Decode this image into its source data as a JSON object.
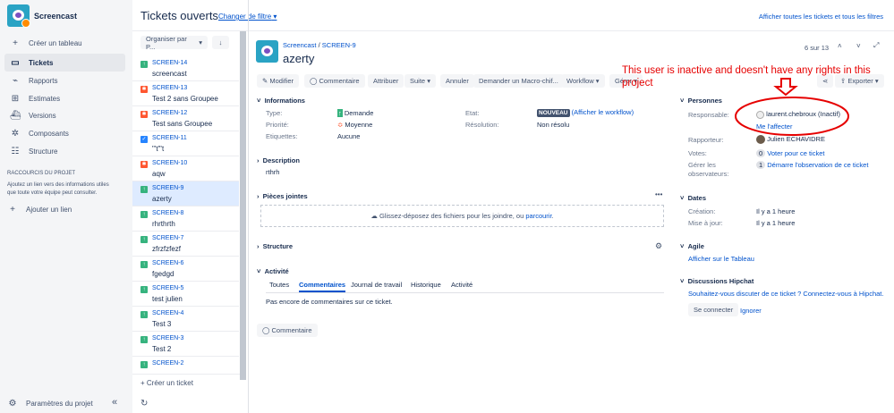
{
  "project": {
    "name": "Screencast"
  },
  "sidebar": {
    "create_board": "Créer un tableau",
    "items": [
      {
        "label": "Tickets",
        "icon": "tickets-icon"
      },
      {
        "label": "Rapports",
        "icon": "chart-icon"
      },
      {
        "label": "Estimates",
        "icon": "estimates-icon"
      },
      {
        "label": "Versions",
        "icon": "ship-icon"
      },
      {
        "label": "Composants",
        "icon": "puzzle-icon"
      },
      {
        "label": "Structure",
        "icon": "structure-icon"
      }
    ],
    "shortcuts_title": "RACCOURCIS DU PROJET",
    "shortcuts_text1": "Ajoutez un lien vers des informations utiles",
    "shortcuts_text2": "que toute votre équipe peut consulter.",
    "add_link": "Ajouter un lien",
    "settings": "Paramètres du projet"
  },
  "list": {
    "title": "Tickets ouverts",
    "change_filter": "Changer de filtre",
    "show_all": "Afficher toutes les tickets et tous les filtres",
    "sort": "Organiser par P...",
    "create": "Créer un ticket",
    "tickets": [
      {
        "id": "SCREEN-14",
        "title": "screencast",
        "type": "story"
      },
      {
        "id": "SCREEN-13",
        "title": "Test 2 sans Groupee",
        "type": "bug"
      },
      {
        "id": "SCREEN-12",
        "title": "Test sans Groupee",
        "type": "bug"
      },
      {
        "id": "SCREEN-11",
        "title": "\"'t\"'t",
        "type": "task"
      },
      {
        "id": "SCREEN-10",
        "title": "aqw",
        "type": "bug"
      },
      {
        "id": "SCREEN-9",
        "title": "azerty",
        "type": "story",
        "selected": true
      },
      {
        "id": "SCREEN-8",
        "title": "rhrthrth",
        "type": "story"
      },
      {
        "id": "SCREEN-7",
        "title": "zfrzfzfezf",
        "type": "story"
      },
      {
        "id": "SCREEN-6",
        "title": "fgedgd",
        "type": "story"
      },
      {
        "id": "SCREEN-5",
        "title": "test julien",
        "type": "story"
      },
      {
        "id": "SCREEN-4",
        "title": "Test 3",
        "type": "story"
      },
      {
        "id": "SCREEN-3",
        "title": "Test 2",
        "type": "story"
      },
      {
        "id": "SCREEN-2",
        "title": "",
        "type": "story"
      }
    ]
  },
  "issue": {
    "breadcrumb_project": "Screencast",
    "breadcrumb_key": "SCREEN-9",
    "title": "azerty",
    "pager": "6 sur 13",
    "actions": [
      "Modifier",
      "Commentaire",
      "Attribuer",
      "Suite",
      "Annuler",
      "Demander un Macro-chif...",
      "Workflow",
      "Gérer"
    ],
    "export": "Exporter",
    "info": {
      "title": "Informations",
      "type_label": "Type:",
      "type": "Demande",
      "priority_label": "Priorité:",
      "priority": "Moyenne",
      "labels_label": "Etiquettes:",
      "labels": "Aucune",
      "status_label": "Etat:",
      "status": "NOUVEAU",
      "workflow": "(Afficher le workflow)",
      "resolution_label": "Résolution:",
      "resolution": "Non résolu"
    },
    "description": {
      "title": "Description",
      "text": "rthrh"
    },
    "attachments": {
      "title": "Pièces jointes",
      "drop1": "Glissez-déposez des fichiers pour les joindre, ou ",
      "drop2": "parcourir",
      "drop3": "."
    },
    "structure": "Structure",
    "activity": {
      "title": "Activité",
      "tabs": [
        "Toutes",
        "Commentaires",
        "Journal de travail",
        "Historique",
        "Activité"
      ],
      "empty": "Pas encore de commentaires sur ce ticket.",
      "comment_btn": "Commentaire"
    },
    "people": {
      "title": "Personnes",
      "assignee_label": "Responsable:",
      "assignee": "laurent.chebroux (Inactif)",
      "assign_me": "Me l'affecter",
      "reporter_label": "Rapporteur:",
      "reporter": "Julien ECHAVIDRE",
      "votes_label": "Votes:",
      "votes": "0",
      "vote_link": "Voter pour ce ticket",
      "watchers_label1": "Gérer les",
      "watchers_label2": "observateurs:",
      "watchers": "1",
      "watch_link": "Démarre l'observation de ce ticket"
    },
    "dates": {
      "title": "Dates",
      "created_label": "Création:",
      "created": "Il y a 1 heure",
      "updated_label": "Mise à jour:",
      "updated": "Il y a 1 heure"
    },
    "agile": {
      "title": "Agile",
      "link": "Afficher sur le Tableau"
    },
    "hipchat": {
      "title": "Discussions Hipchat",
      "text": "Souhaitez-vous discuter de ce ticket ? Connectez-vous à Hipchat.",
      "connect": "Se connecter",
      "ignore": "Ignorer"
    }
  },
  "annotation": {
    "text1": "This user is inactive and doesn't have any rights in this",
    "text2": "project",
    "color": "#e60000"
  }
}
